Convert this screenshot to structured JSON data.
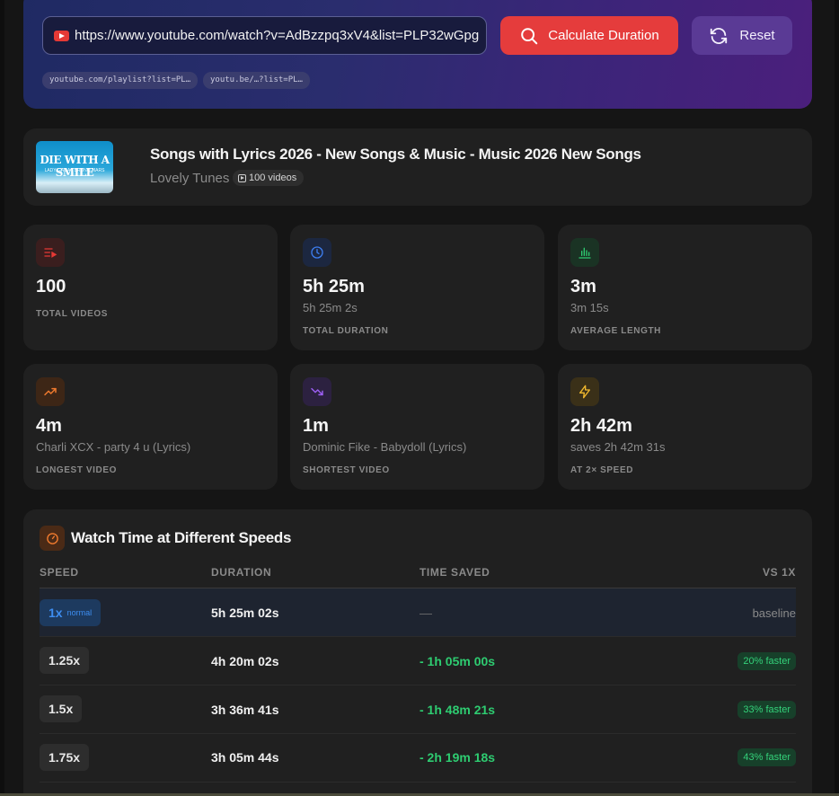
{
  "hero": {
    "url_value": "https://www.youtube.com/watch?v=AdBzzpq3xV4&list=PLP32wGpg",
    "calculate_label": "Calculate Duration",
    "reset_label": "Reset",
    "example_chips": [
      "youtube.com/playlist?list=PL…",
      "youtu.be/…?list=PL…"
    ]
  },
  "playlist": {
    "thumbnail_text": "DIE WITH A SMILE",
    "thumbnail_subtext": "LADY GAGA · BRUNO MARS",
    "title": "Songs with Lyrics 2026 - New Songs & Music - Music 2026 New Songs",
    "channel": "Lovely Tunes",
    "video_count": "100 videos"
  },
  "stats": [
    {
      "icon": "playlist-icon",
      "value": "100",
      "sub": "",
      "label": "TOTAL VIDEOS",
      "color": "#e53935",
      "bg": "#3a1e1e"
    },
    {
      "icon": "clock-icon",
      "value": "5h 25m",
      "sub": "5h 25m 2s",
      "label": "TOTAL DURATION",
      "color": "#3d7ef0",
      "bg": "#1c2740"
    },
    {
      "icon": "bar-chart-icon",
      "value": "3m",
      "sub": "3m 15s",
      "label": "AVERAGE LENGTH",
      "color": "#2ecc71",
      "bg": "#1a3324"
    },
    {
      "icon": "trending-up-icon",
      "value": "4m",
      "sub": "Charli XCX - party 4 u (Lyrics)",
      "label": "LONGEST VIDEO",
      "color": "#f07a2e",
      "bg": "#3d2616"
    },
    {
      "icon": "trending-down-icon",
      "value": "1m",
      "sub": "Dominic Fike - Babydoll (Lyrics)",
      "label": "SHORTEST VIDEO",
      "color": "#9b5ef0",
      "bg": "#2c2140"
    },
    {
      "icon": "lightning-icon",
      "value": "2h 42m",
      "sub": "saves 2h 42m 31s",
      "label": "AT 2× SPEED",
      "color": "#f0b82e",
      "bg": "#3a3018"
    }
  ],
  "speeds": {
    "title": "Watch Time at Different Speeds",
    "headers": {
      "speed": "SPEED",
      "duration": "DURATION",
      "saved": "TIME SAVED",
      "vs": "VS 1X"
    },
    "rows": [
      {
        "speed": "1x",
        "note": "normal",
        "duration": "5h 25m 02s",
        "saved": "—",
        "vs": "baseline"
      },
      {
        "speed": "1.25x",
        "note": "",
        "duration": "4h 20m 02s",
        "saved": "- 1h 05m 00s",
        "vs": "20% faster"
      },
      {
        "speed": "1.5x",
        "note": "",
        "duration": "3h 36m 41s",
        "saved": "- 1h 48m 21s",
        "vs": "33% faster"
      },
      {
        "speed": "1.75x",
        "note": "",
        "duration": "3h 05m 44s",
        "saved": "- 2h 19m 18s",
        "vs": "43% faster"
      }
    ]
  }
}
